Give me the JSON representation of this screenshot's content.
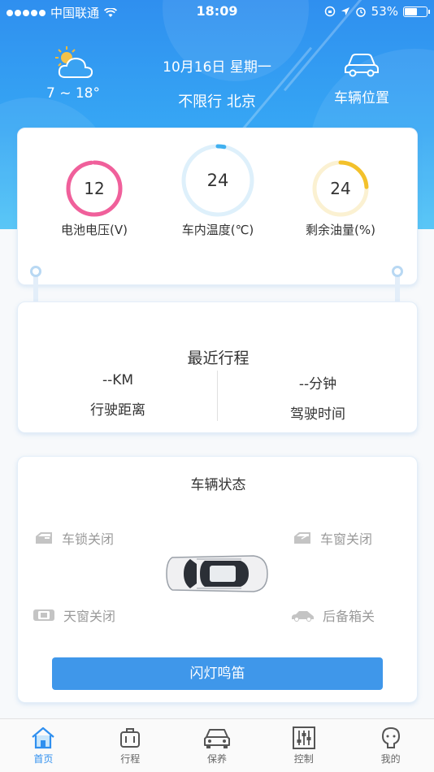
{
  "statusbar": {
    "carrier": "中国联通",
    "time": "18:09",
    "battery": "53%"
  },
  "weather": {
    "icon": "partly-cloudy-icon",
    "temp": "7 ~ 18°"
  },
  "header": {
    "date": "10月16日  星期一",
    "limit": "不限行 北京",
    "car_position": "车辆位置"
  },
  "gauges": [
    {
      "value": "12",
      "label": "电池电压(V)",
      "color": "#f0609b",
      "fraction": 0.98
    },
    {
      "value": "24",
      "label": "车内温度(℃)",
      "color": "#3fb0f0",
      "fraction": 0.03
    },
    {
      "value": "24",
      "label": "剩余油量(%)",
      "color": "#f3c12b",
      "fraction": 0.24
    }
  ],
  "trip": {
    "title": "最近行程",
    "distance_value": "--KM",
    "distance_label": "行驶距离",
    "time_value": "--分钟",
    "time_label": "驾驶时间"
  },
  "vehicle_status": {
    "title": "车辆状态",
    "lock": "车锁关闭",
    "window": "车窗关闭",
    "sunroof": "天窗关闭",
    "trunk": "后备箱关",
    "flash_button": "闪灯鸣笛"
  },
  "tabs": [
    {
      "label": "首页",
      "icon": "home-icon",
      "active": true
    },
    {
      "label": "行程",
      "icon": "luggage-icon",
      "active": false
    },
    {
      "label": "保养",
      "icon": "car-front-icon",
      "active": false
    },
    {
      "label": "控制",
      "icon": "control-sliders-icon",
      "active": false
    },
    {
      "label": "我的",
      "icon": "profile-icon",
      "active": false
    }
  ],
  "colors": {
    "primary": "#2f8fef",
    "button": "#3f97ea"
  }
}
